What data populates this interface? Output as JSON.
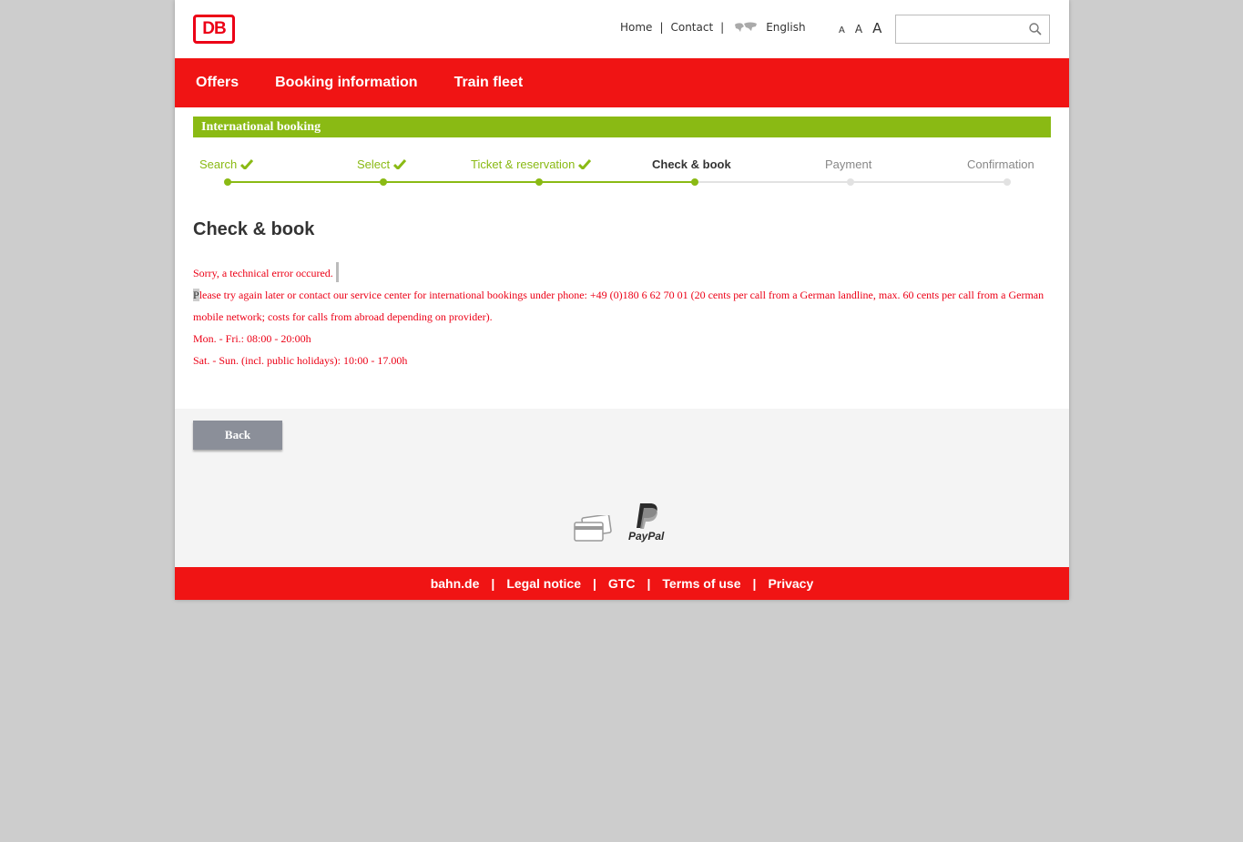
{
  "header": {
    "logo_text": "DB",
    "links": {
      "home": "Home",
      "contact": "Contact",
      "language": "English",
      "sep": "|"
    },
    "font_sizes": [
      "A",
      "A",
      "A"
    ],
    "search_placeholder": ""
  },
  "nav": {
    "items": [
      "Offers",
      "Booking information",
      "Train fleet"
    ]
  },
  "band": {
    "title": "International booking"
  },
  "steps": [
    {
      "label": "Search",
      "state": "done"
    },
    {
      "label": "Select",
      "state": "done"
    },
    {
      "label": "Ticket & reservation",
      "state": "done"
    },
    {
      "label": "Check & book",
      "state": "current"
    },
    {
      "label": "Payment",
      "state": "todo"
    },
    {
      "label": "Confirmation",
      "state": "todo"
    }
  ],
  "main": {
    "heading": "Check & book",
    "error_line1": "Sorry, a technical error occured.",
    "error_line2_first": "P",
    "error_line2_rest": "lease try again later or contact our service center for international bookings under phone: +49 (0)180 6 62 70 01 (20 cents per call from a German landline, max. 60 cents per call from a German mobile network; costs for calls from abroad depending on provider).",
    "hours_weekday": "Mon. - Fri.: 08:00 - 20:00h",
    "hours_weekend": "Sat. - Sun. (incl. public holidays): 10:00 - 17.00h"
  },
  "actions": {
    "back_label": "Back"
  },
  "payment": {
    "paypal_label": "PayPal",
    "icons": [
      "credit-card-icon",
      "paypal-icon"
    ]
  },
  "footer": {
    "links": [
      "bahn.de",
      "Legal notice",
      "GTC",
      "Terms of use",
      "Privacy"
    ],
    "sep": "|"
  },
  "colors": {
    "brand_red": "#f01414",
    "db_red": "#ec0016",
    "green": "#8aba14",
    "button_gray": "#8b8f99"
  }
}
